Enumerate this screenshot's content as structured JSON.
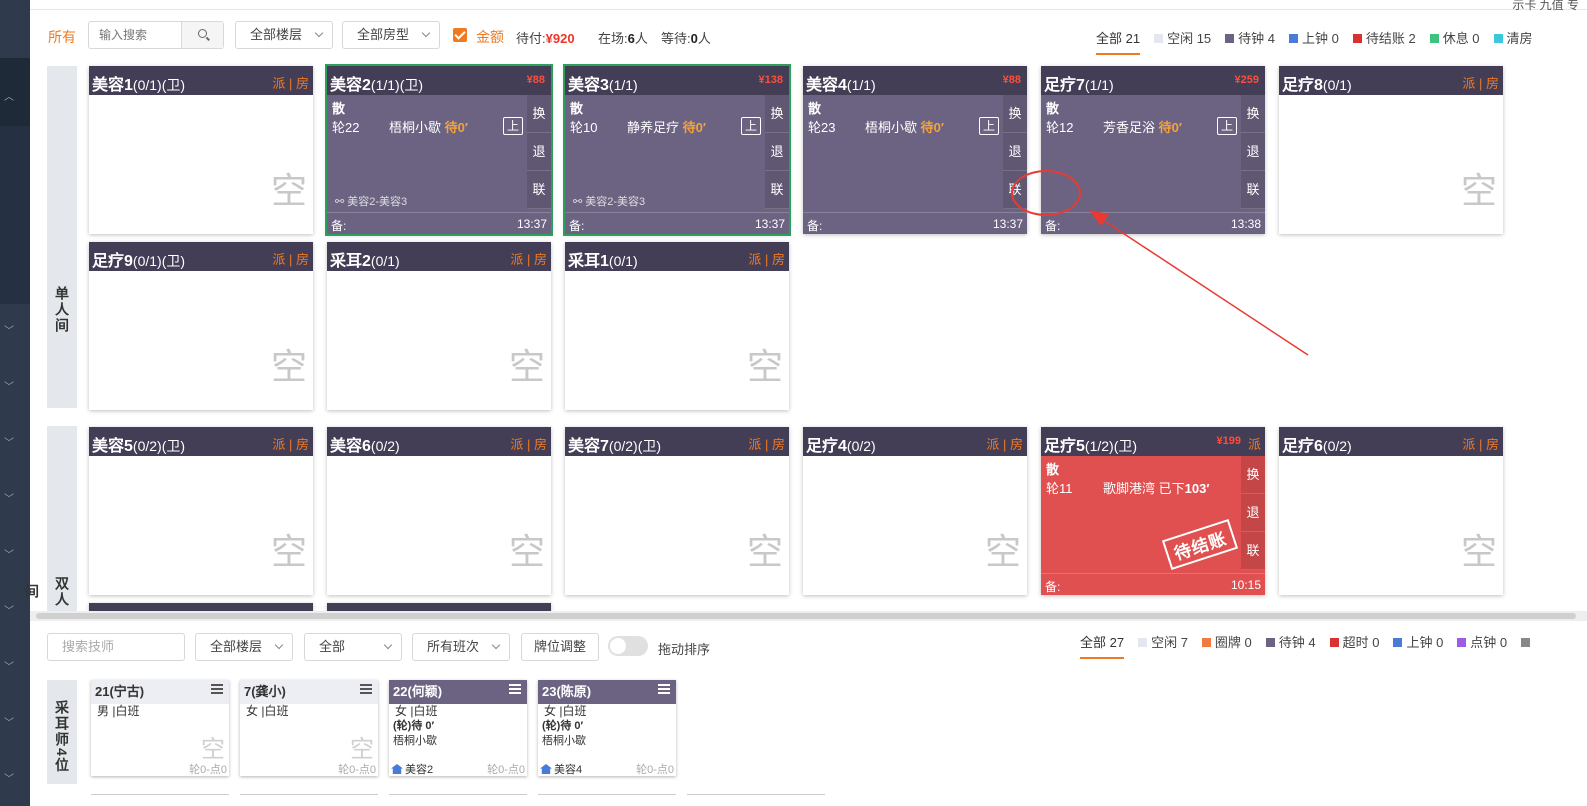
{
  "top_right_text": "示卡  九值  专",
  "toolbar": {
    "all_tab": "所有",
    "search_placeholder": "输入搜索",
    "floor_select": "全部楼层",
    "roomtype_select": "全部房型",
    "amount_label": "金额",
    "pending_label": "待付:",
    "pending_value": "¥920",
    "onsite_label": "在场:",
    "onsite_value": "6",
    "onsite_unit": "人",
    "waiting_label": "等待:",
    "waiting_value": "0",
    "waiting_unit": "人"
  },
  "room_filters": [
    {
      "label": "全部 21",
      "color": ""
    },
    {
      "label": "空闲 15",
      "color": "#e4e7ef"
    },
    {
      "label": "待钟 4",
      "color": "#6b6381"
    },
    {
      "label": "上钟 0",
      "color": "#4a7bd6"
    },
    {
      "label": "待结账 2",
      "color": "#d93030"
    },
    {
      "label": "休息 0",
      "color": "#3cc47c"
    },
    {
      "label": "清房",
      "color": "#3cc8d8"
    }
  ],
  "groups": {
    "single": "单人间",
    "double": "双人间"
  },
  "rooms": [
    {
      "name": "美容1",
      "cap": "(0/1)(卫)",
      "acts": "派 | 房",
      "empty": "空"
    },
    {
      "name": "美容2",
      "cap": "(1/1)(卫)",
      "price": "¥88",
      "type": "散",
      "lun": "轮22",
      "service": "梧桐小歇",
      "wait": "待0′",
      "up": "上",
      "link": "美容2-美容3",
      "note": "备:",
      "time": "13:37"
    },
    {
      "name": "美容3",
      "cap": "(1/1)",
      "price": "¥138",
      "type": "散",
      "lun": "轮10",
      "service": "静养足疗",
      "wait": "待0′",
      "up": "上",
      "link": "美容2-美容3",
      "note": "备:",
      "time": "13:37"
    },
    {
      "name": "美容4",
      "cap": "(1/1)",
      "price": "¥88",
      "type": "散",
      "lun": "轮23",
      "service": "梧桐小歇",
      "wait": "待0′",
      "up": "上",
      "note": "备:",
      "time": "13:37"
    },
    {
      "name": "足疗7",
      "cap": "(1/1)",
      "price": "¥259",
      "type": "散",
      "lun": "轮12",
      "service": "芳香足浴",
      "wait": "待0′",
      "up": "上",
      "note": "备:",
      "time": "13:38"
    },
    {
      "name": "足疗8",
      "cap": "(0/1)",
      "acts": "派 | 房",
      "empty": "空"
    },
    {
      "name": "足疗9",
      "cap": "(0/1)(卫)",
      "acts": "派 | 房",
      "empty": "空"
    },
    {
      "name": "采耳2",
      "cap": "(0/1)",
      "acts": "派 | 房",
      "empty": "空"
    },
    {
      "name": "采耳1",
      "cap": "(0/1)",
      "acts": "派 | 房",
      "empty": "空"
    },
    {
      "name": "美容5",
      "cap": "(0/2)(卫)",
      "acts": "派 | 房",
      "empty": "空"
    },
    {
      "name": "美容6",
      "cap": "(0/2)",
      "acts": "派 | 房",
      "empty": "空"
    },
    {
      "name": "美容7",
      "cap": "(0/2)(卫)",
      "acts": "派 | 房",
      "empty": "空"
    },
    {
      "name": "足疗4",
      "cap": "(0/2)",
      "acts": "派 | 房",
      "empty": "空"
    },
    {
      "name": "足疗5",
      "cap": "(1/2)(卫)",
      "price": "¥199",
      "acts": "派",
      "type": "散",
      "lun": "轮11",
      "service": "歌脚港湾",
      "wait_prefix": "已下",
      "wait": "103′",
      "stamp": "待结账",
      "note": "备:",
      "time": "10:15"
    },
    {
      "name": "足疗6",
      "cap": "(0/2)",
      "acts": "派 | 房",
      "empty": "空"
    }
  ],
  "side_actions": [
    "换",
    "退",
    "联"
  ],
  "bottom_toolbar": {
    "search_placeholder": "搜索技师",
    "floor_select": "全部楼层",
    "all_select": "全部",
    "shift_select": "所有班次",
    "adjust_button": "牌位调整",
    "drag_label": "拖动排序"
  },
  "tech_filters": [
    {
      "label": "全部 27",
      "color": ""
    },
    {
      "label": "空闲 7",
      "color": "#e4e7ef"
    },
    {
      "label": "圈牌 0",
      "color": "#f07a40"
    },
    {
      "label": "待钟 4",
      "color": "#6b6381"
    },
    {
      "label": "超时 0",
      "color": "#d93030"
    },
    {
      "label": "上钟 0",
      "color": "#4a7bd6"
    },
    {
      "label": "点钟 0",
      "color": "#9b5de5"
    },
    {
      "label": "",
      "color": "#888"
    }
  ],
  "tech_group": "采耳师4位",
  "techs": [
    {
      "name": "21(宁古)",
      "info": "男 |白班",
      "empty": "空",
      "cnt": "轮0-点0"
    },
    {
      "name": "7(龚小)",
      "info": "女 |白班",
      "empty": "空",
      "cnt": "轮0-点0"
    },
    {
      "name": "22(何颖)",
      "info": "女 |白班",
      "wait": "(轮)待 0′",
      "service": "梧桐小歇",
      "room": "美容2",
      "cnt": "轮0-点0"
    },
    {
      "name": "23(陈原)",
      "info": "女 |白班",
      "wait": "(轮)待 0′",
      "service": "梧桐小歇",
      "room": "美容4",
      "cnt": "轮0-点0"
    }
  ]
}
